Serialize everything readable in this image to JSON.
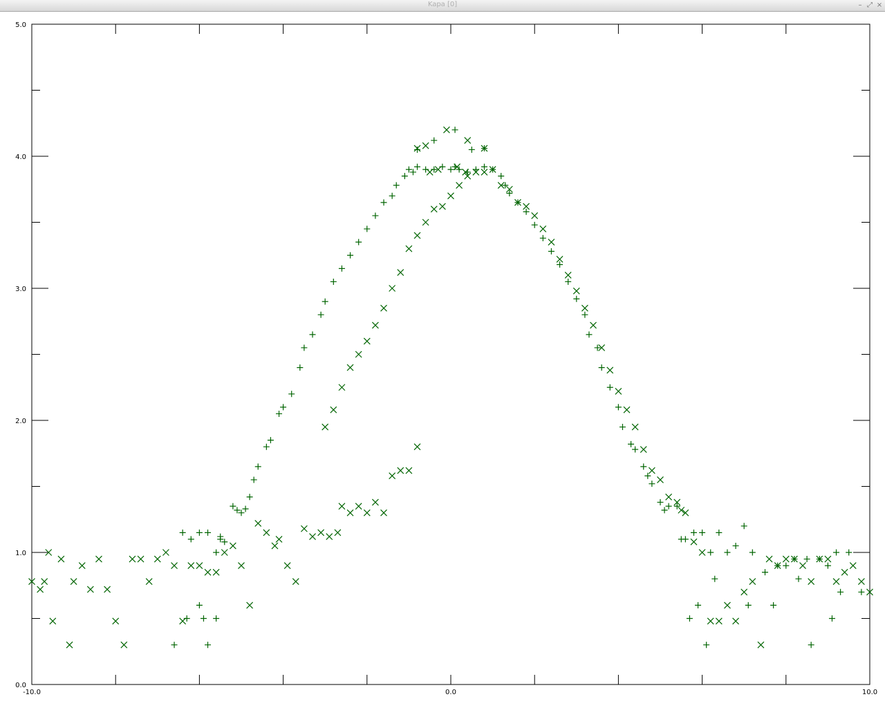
{
  "window": {
    "title": "Kapa [0]",
    "minimize_glyph": "–",
    "maximize_glyph": "⤢",
    "close_glyph": "×"
  },
  "chart_data": {
    "type": "scatter",
    "title": "",
    "xlabel": "",
    "ylabel": "",
    "xlim": [
      -10.0,
      10.0
    ],
    "ylim": [
      0.0,
      5.0
    ],
    "x_ticks": [
      -10.0,
      -8.0,
      -6.0,
      -4.0,
      -2.0,
      0.0,
      2.0,
      4.0,
      6.0,
      8.0,
      10.0
    ],
    "x_tick_labels": [
      "-10.0",
      "",
      "",
      "",
      "",
      "0.0",
      "",
      "",
      "",
      "",
      "10.0"
    ],
    "y_ticks": [
      0.0,
      0.5,
      1.0,
      1.5,
      2.0,
      2.5,
      3.0,
      3.5,
      4.0,
      4.5,
      5.0
    ],
    "y_tick_labels": [
      "0.0",
      "",
      "1.0",
      "",
      "2.0",
      "",
      "3.0",
      "",
      "4.0",
      "",
      "5.0"
    ],
    "grid": false,
    "marker_color": "#006400",
    "series": [
      {
        "marker": "plus",
        "points": [
          [
            -5.6,
            1.0
          ],
          [
            -5.5,
            1.12
          ],
          [
            -5.4,
            1.08
          ],
          [
            -5.2,
            1.35
          ],
          [
            -5.1,
            1.32
          ],
          [
            -5.0,
            1.3
          ],
          [
            -4.9,
            1.33
          ],
          [
            -4.8,
            1.42
          ],
          [
            -4.7,
            1.55
          ],
          [
            -4.6,
            1.65
          ],
          [
            -4.4,
            1.8
          ],
          [
            -4.3,
            1.85
          ],
          [
            -4.1,
            2.05
          ],
          [
            -4.0,
            2.1
          ],
          [
            -3.8,
            2.2
          ],
          [
            -3.6,
            2.4
          ],
          [
            -3.5,
            2.55
          ],
          [
            -3.3,
            2.65
          ],
          [
            -3.1,
            2.8
          ],
          [
            -3.0,
            2.9
          ],
          [
            -2.8,
            3.05
          ],
          [
            -2.6,
            3.15
          ],
          [
            -2.4,
            3.25
          ],
          [
            -2.2,
            3.35
          ],
          [
            -2.0,
            3.45
          ],
          [
            -1.8,
            3.55
          ],
          [
            -1.6,
            3.65
          ],
          [
            -1.4,
            3.7
          ],
          [
            -1.3,
            3.78
          ],
          [
            -1.1,
            3.85
          ],
          [
            -1.0,
            3.9
          ],
          [
            -0.9,
            3.88
          ],
          [
            -0.8,
            3.92
          ],
          [
            -0.6,
            3.9
          ],
          [
            -0.4,
            3.9
          ],
          [
            -0.2,
            3.92
          ],
          [
            0.0,
            3.9
          ],
          [
            0.1,
            3.92
          ],
          [
            0.2,
            3.9
          ],
          [
            0.4,
            3.88
          ],
          [
            0.6,
            3.9
          ],
          [
            0.8,
            3.92
          ],
          [
            1.0,
            3.9
          ],
          [
            1.2,
            3.85
          ],
          [
            1.3,
            3.78
          ],
          [
            1.4,
            3.72
          ],
          [
            1.6,
            3.65
          ],
          [
            1.8,
            3.58
          ],
          [
            2.0,
            3.48
          ],
          [
            2.2,
            3.38
          ],
          [
            2.4,
            3.28
          ],
          [
            2.6,
            3.18
          ],
          [
            2.8,
            3.05
          ],
          [
            3.0,
            2.92
          ],
          [
            3.2,
            2.8
          ],
          [
            3.3,
            2.65
          ],
          [
            3.5,
            2.55
          ],
          [
            3.6,
            2.4
          ],
          [
            3.8,
            2.25
          ],
          [
            4.0,
            2.1
          ],
          [
            4.1,
            1.95
          ],
          [
            4.3,
            1.82
          ],
          [
            4.4,
            1.78
          ],
          [
            4.6,
            1.65
          ],
          [
            4.7,
            1.58
          ],
          [
            4.8,
            1.52
          ],
          [
            5.0,
            1.38
          ],
          [
            5.1,
            1.32
          ],
          [
            5.2,
            1.35
          ],
          [
            5.4,
            1.35
          ],
          [
            5.5,
            1.1
          ],
          [
            5.6,
            1.1
          ],
          [
            5.8,
            1.15
          ],
          [
            6.0,
            1.15
          ],
          [
            6.2,
            1.0
          ],
          [
            6.4,
            1.15
          ],
          [
            6.6,
            1.0
          ],
          [
            6.8,
            1.05
          ],
          [
            7.0,
            1.2
          ],
          [
            7.2,
            1.0
          ],
          [
            7.5,
            0.85
          ],
          [
            7.8,
            0.9
          ],
          [
            8.0,
            0.9
          ],
          [
            8.2,
            0.95
          ],
          [
            8.5,
            0.95
          ],
          [
            8.8,
            0.95
          ],
          [
            9.0,
            0.9
          ],
          [
            9.2,
            1.0
          ],
          [
            9.5,
            1.0
          ],
          [
            9.8,
            0.7
          ],
          [
            9.3,
            0.7
          ],
          [
            9.1,
            0.5
          ],
          [
            8.6,
            0.3
          ],
          [
            8.3,
            0.8
          ],
          [
            7.7,
            0.6
          ],
          [
            7.1,
            0.6
          ],
          [
            6.3,
            0.8
          ],
          [
            6.1,
            0.3
          ],
          [
            5.9,
            0.6
          ],
          [
            5.7,
            0.5
          ],
          [
            -5.8,
            0.3
          ],
          [
            -5.6,
            0.5
          ],
          [
            -5.9,
            0.5
          ],
          [
            -6.0,
            0.6
          ],
          [
            -6.3,
            0.5
          ],
          [
            -6.6,
            0.3
          ],
          [
            -5.5,
            1.1
          ],
          [
            -5.8,
            1.15
          ],
          [
            -6.0,
            1.15
          ],
          [
            -6.2,
            1.1
          ],
          [
            -6.4,
            1.15
          ],
          [
            0.1,
            4.2
          ],
          [
            0.5,
            4.05
          ],
          [
            -0.4,
            4.12
          ],
          [
            0.8,
            4.06
          ],
          [
            -0.8,
            4.05
          ]
        ]
      },
      {
        "marker": "cross",
        "points": [
          [
            -10.0,
            0.78
          ],
          [
            -9.8,
            0.72
          ],
          [
            -9.7,
            0.78
          ],
          [
            -9.6,
            1.0
          ],
          [
            -9.5,
            0.48
          ],
          [
            -9.3,
            0.95
          ],
          [
            -9.1,
            0.3
          ],
          [
            -9.0,
            0.78
          ],
          [
            -8.8,
            0.9
          ],
          [
            -8.6,
            0.72
          ],
          [
            -8.4,
            0.95
          ],
          [
            -8.2,
            0.72
          ],
          [
            -8.0,
            0.48
          ],
          [
            -7.8,
            0.3
          ],
          [
            -7.6,
            0.95
          ],
          [
            -7.4,
            0.95
          ],
          [
            -7.2,
            0.78
          ],
          [
            -7.0,
            0.95
          ],
          [
            -6.8,
            1.0
          ],
          [
            -6.6,
            0.9
          ],
          [
            -6.4,
            0.48
          ],
          [
            -6.2,
            0.9
          ],
          [
            -6.0,
            0.9
          ],
          [
            -5.8,
            0.85
          ],
          [
            -5.6,
            0.85
          ],
          [
            -5.4,
            1.0
          ],
          [
            -5.2,
            1.05
          ],
          [
            -5.0,
            0.9
          ],
          [
            -4.8,
            0.6
          ],
          [
            -4.6,
            1.22
          ],
          [
            -4.4,
            1.15
          ],
          [
            -4.2,
            1.05
          ],
          [
            -4.1,
            1.1
          ],
          [
            -3.9,
            0.9
          ],
          [
            -3.7,
            0.78
          ],
          [
            -3.5,
            1.18
          ],
          [
            -3.3,
            1.12
          ],
          [
            -3.1,
            1.15
          ],
          [
            -2.9,
            1.12
          ],
          [
            -2.7,
            1.15
          ],
          [
            -2.6,
            1.35
          ],
          [
            -2.4,
            1.3
          ],
          [
            -2.2,
            1.35
          ],
          [
            -2.0,
            1.3
          ],
          [
            -1.8,
            1.38
          ],
          [
            -1.6,
            1.3
          ],
          [
            -1.4,
            1.58
          ],
          [
            -1.2,
            1.62
          ],
          [
            -1.0,
            1.62
          ],
          [
            -0.8,
            1.8
          ],
          [
            -3.0,
            1.95
          ],
          [
            -2.8,
            2.08
          ],
          [
            -2.6,
            2.25
          ],
          [
            -2.4,
            2.4
          ],
          [
            -2.2,
            2.5
          ],
          [
            -2.0,
            2.6
          ],
          [
            -1.8,
            2.72
          ],
          [
            -1.6,
            2.85
          ],
          [
            -1.4,
            3.0
          ],
          [
            -1.2,
            3.12
          ],
          [
            -1.0,
            3.3
          ],
          [
            -0.8,
            3.4
          ],
          [
            -0.6,
            3.5
          ],
          [
            -0.4,
            3.6
          ],
          [
            -0.2,
            3.62
          ],
          [
            0.0,
            3.7
          ],
          [
            0.2,
            3.78
          ],
          [
            0.4,
            3.85
          ],
          [
            0.6,
            3.88
          ],
          [
            0.8,
            3.88
          ],
          [
            1.0,
            3.9
          ],
          [
            1.2,
            3.78
          ],
          [
            1.4,
            3.75
          ],
          [
            1.6,
            3.65
          ],
          [
            1.8,
            3.62
          ],
          [
            2.0,
            3.55
          ],
          [
            2.2,
            3.45
          ],
          [
            2.4,
            3.35
          ],
          [
            2.6,
            3.22
          ],
          [
            2.8,
            3.1
          ],
          [
            3.0,
            2.98
          ],
          [
            3.2,
            2.85
          ],
          [
            3.4,
            2.72
          ],
          [
            3.6,
            2.55
          ],
          [
            3.8,
            2.38
          ],
          [
            4.0,
            2.22
          ],
          [
            4.2,
            2.08
          ],
          [
            4.4,
            1.95
          ],
          [
            4.6,
            1.78
          ],
          [
            4.8,
            1.62
          ],
          [
            5.0,
            1.55
          ],
          [
            5.2,
            1.42
          ],
          [
            5.4,
            1.38
          ],
          [
            5.5,
            1.32
          ],
          [
            5.6,
            1.3
          ],
          [
            5.8,
            1.08
          ],
          [
            6.0,
            1.0
          ],
          [
            6.2,
            0.48
          ],
          [
            6.4,
            0.48
          ],
          [
            6.6,
            0.6
          ],
          [
            6.8,
            0.48
          ],
          [
            7.0,
            0.7
          ],
          [
            7.2,
            0.78
          ],
          [
            7.4,
            0.3
          ],
          [
            7.6,
            0.95
          ],
          [
            7.8,
            0.9
          ],
          [
            8.0,
            0.95
          ],
          [
            8.2,
            0.95
          ],
          [
            8.4,
            0.9
          ],
          [
            8.6,
            0.78
          ],
          [
            8.8,
            0.95
          ],
          [
            9.0,
            0.95
          ],
          [
            9.2,
            0.78
          ],
          [
            9.4,
            0.85
          ],
          [
            9.6,
            0.9
          ],
          [
            9.8,
            0.78
          ],
          [
            10.0,
            0.7
          ],
          [
            -0.1,
            4.2
          ],
          [
            0.4,
            4.12
          ],
          [
            -0.6,
            4.08
          ],
          [
            0.8,
            4.06
          ],
          [
            -0.8,
            4.06
          ],
          [
            0.15,
            3.92
          ],
          [
            -0.3,
            3.9
          ],
          [
            0.35,
            3.88
          ],
          [
            -0.5,
            3.88
          ]
        ]
      }
    ]
  }
}
